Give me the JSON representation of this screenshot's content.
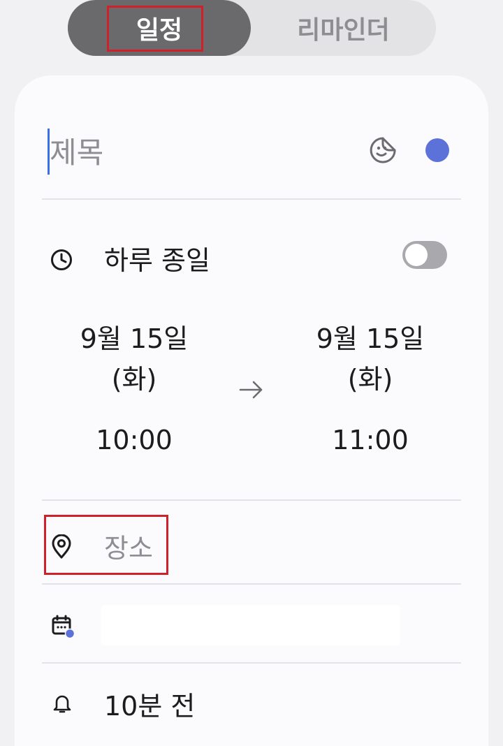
{
  "tabs": {
    "event": "일정",
    "reminder": "리마인더"
  },
  "title_field": {
    "placeholder": "제목",
    "color": "#5d72d9"
  },
  "all_day": {
    "label": "하루 종일",
    "enabled": false
  },
  "start": {
    "date": "9월 15일",
    "weekday": "(화)",
    "time": "10:00"
  },
  "end": {
    "date": "9월 15일",
    "weekday": "(화)",
    "time": "11:00"
  },
  "location": {
    "placeholder": "장소"
  },
  "calendar": {
    "icon": "calendar-icon"
  },
  "alert": {
    "label": "10분 전"
  },
  "icons": {
    "sticker": "sticker-icon",
    "clock": "clock-icon",
    "arrow": "arrow-right-icon",
    "location": "location-pin-icon",
    "bell": "bell-icon"
  }
}
